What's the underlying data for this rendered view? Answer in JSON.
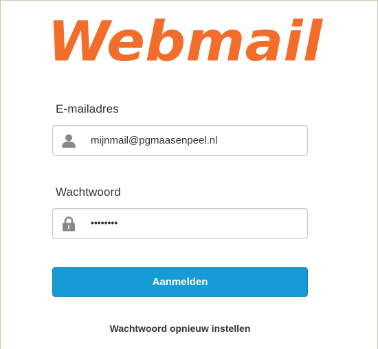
{
  "brand": {
    "logo_text": "Webmail",
    "logo_color": "#f26c2a"
  },
  "login": {
    "email_label": "E-mailadres",
    "email_value": "mijnmail@pgmaasenpeel.nl",
    "password_label": "Wachtwoord",
    "password_value": "••••••••",
    "submit_label": "Aanmelden",
    "reset_link": "Wachtwoord opnieuw instellen"
  },
  "colors": {
    "button": "#179bd7",
    "icon": "#888888"
  },
  "icons": {
    "email_field": "user-icon",
    "password_field": "lock-icon"
  }
}
